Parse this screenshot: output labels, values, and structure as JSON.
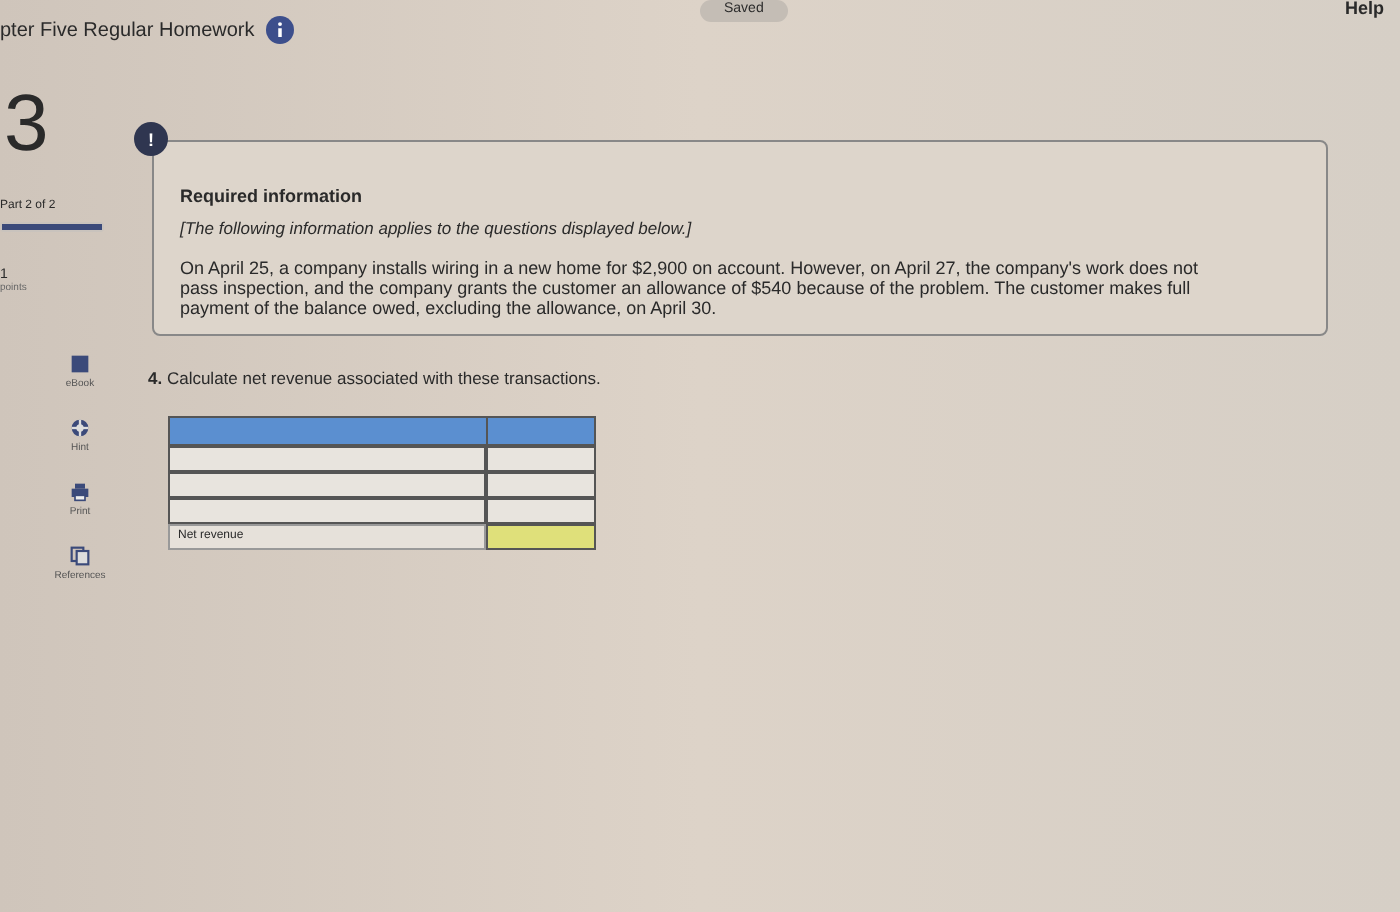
{
  "header": {
    "title": "pter Five Regular Homework",
    "status": "Saved",
    "help": "Help"
  },
  "sidebar": {
    "question_number": "3",
    "part": "Part 2 of 2",
    "progress": {
      "level": 1
    },
    "points": "1",
    "points_label": "points",
    "tools": [
      {
        "kind": "ebook",
        "label": "eBook"
      },
      {
        "kind": "hint",
        "label": "Hint"
      },
      {
        "kind": "print",
        "label": "Print"
      },
      {
        "kind": "references",
        "label": "References"
      }
    ]
  },
  "info_card": {
    "badge": "!",
    "heading": "Required information",
    "note": "[The following information applies to the questions displayed below.]",
    "body": "On April 25, a company installs wiring in a new home for $2,900 on account. However, on April 27, the company's work does not pass inspection, and the company grants the customer an allowance of $540 because of the problem. The customer makes full payment of the balance owed, excluding the allowance, on April 30."
  },
  "question": "**4.** Calculate net revenue associated with these transactions.",
  "table": {
    "rows": [
      {
        "kind": "input"
      },
      {
        "kind": "input"
      },
      {
        "kind": "input"
      },
      {
        "kind": "total",
        "label": "Net revenue"
      }
    ]
  }
}
